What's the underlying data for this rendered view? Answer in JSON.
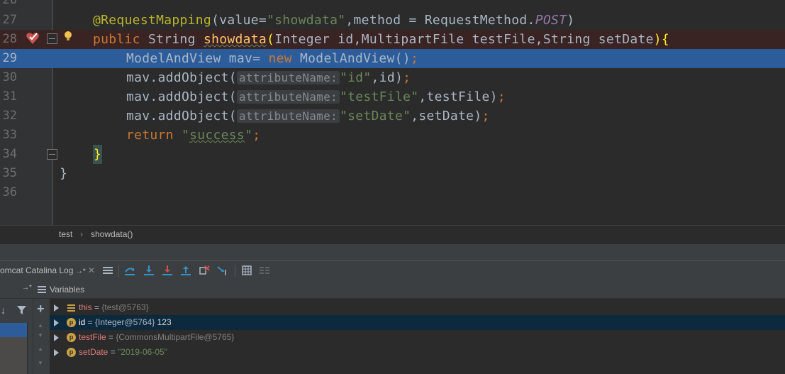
{
  "editor": {
    "lines": [
      {
        "num": "26"
      },
      {
        "num": "27"
      },
      {
        "num": "28"
      },
      {
        "num": "29"
      },
      {
        "num": "30"
      },
      {
        "num": "31"
      },
      {
        "num": "32"
      },
      {
        "num": "33"
      },
      {
        "num": "34"
      },
      {
        "num": "35"
      },
      {
        "num": "36"
      }
    ],
    "code": {
      "l27_annotation": "@RequestMapping",
      "l27_open": "(value=",
      "l27_value": "\"showdata\"",
      "l27_mid": ",method = RequestMethod.",
      "l27_post": "POST",
      "l27_close": ")",
      "l28_public": "public",
      "l28_type": " String ",
      "l28_method": "showdata",
      "l28_open": "(",
      "l28_params": "Integer id,MultipartFile testFile,String setDate",
      "l28_close": ")",
      "l28_brace": "{",
      "l29_decl": "ModelAndView mav= ",
      "l29_new": "new",
      "l29_ctor": " ModelAndView()",
      "l29_semi": ";",
      "l30_call": "mav.addObject(",
      "l30_hint": "attributeName:",
      "l30_arg": "\"id\"",
      "l30_rest": ",id)",
      "l30_semi": ";",
      "l31_call": "mav.addObject(",
      "l31_hint": "attributeName:",
      "l31_arg": "\"testFile\"",
      "l31_rest": ",testFile)",
      "l31_semi": ";",
      "l32_call": "mav.addObject(",
      "l32_hint": "attributeName:",
      "l32_arg": "\"setDate\"",
      "l32_rest": ",setDate)",
      "l32_semi": ";",
      "l33_return": "return",
      "l33_q1": " \"",
      "l33_value": "success",
      "l33_q2": "\"",
      "l33_semi": ";",
      "l34_brace": "}",
      "l35_brace": "}"
    }
  },
  "breadcrumb": {
    "items": [
      "test",
      "showdata()"
    ],
    "separator": "›"
  },
  "debugger": {
    "tab_label": "omcat Catalina Log",
    "tab_suffix": "→*",
    "variables_title": "Variables",
    "variables": [
      {
        "name": "this",
        "eq": " = ",
        "value": "{test@5763}",
        "extra": "",
        "icon": "list-icon"
      },
      {
        "name": "id",
        "eq": " = ",
        "value": "{Integer@5764}",
        "extra": " 123",
        "icon": "p"
      },
      {
        "name": "testFile",
        "eq": " = ",
        "value": "{CommonsMultipartFile@5765}",
        "extra": "",
        "icon": "p"
      },
      {
        "name": "setDate",
        "eq": " = ",
        "value": "\"2019-06-05\"",
        "extra": "",
        "icon": "p"
      }
    ]
  },
  "colors": {
    "background": "#2b2b2b",
    "selection": "#2d5c9b",
    "keyword": "#cc7832",
    "string": "#6a8759",
    "annotation": "#bbb529",
    "method": "#ffc66d"
  }
}
